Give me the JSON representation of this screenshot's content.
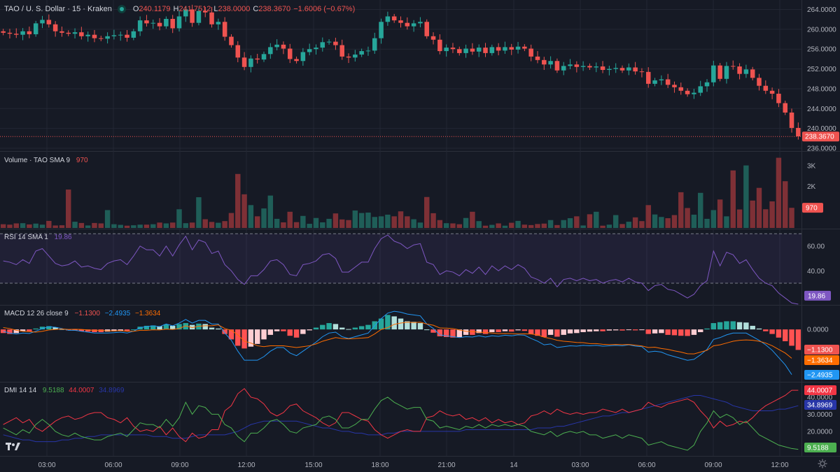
{
  "header": {
    "symbol": "TAO / U. S. Dollar · 15 · Kraken",
    "o_label": "O",
    "o_value": "240.1179",
    "h_label": "H",
    "h_value": "241.7512",
    "l_label": "L",
    "l_value": "238.0000",
    "c_label": "C",
    "c_value": "238.3670",
    "change": "−1.6006 (−0.67%)"
  },
  "colors": {
    "bg": "#161a25",
    "up": "#26a69a",
    "down": "#ef5350",
    "grid": "#232734",
    "rsi": "#7e57c2",
    "macd": "#2196f3",
    "signal": "#ff6d00",
    "dmi_plus": "#4caf50",
    "dmi_minus": "#f23645",
    "adx": "#2836a8"
  },
  "chart_data": [
    {
      "type": "candlestick",
      "title": "TAO / U. S. Dollar · 15 · Kraken",
      "ylim": [
        236,
        264.5
      ],
      "y_ticks": [
        "264.0000",
        "260.0000",
        "256.0000",
        "252.0000",
        "248.0000",
        "244.0000",
        "240.0000",
        "236.0000"
      ],
      "last_price_label": "238.3670",
      "last_price": 238.367,
      "x_ticks": [
        "03:00",
        "06:00",
        "09:00",
        "12:00",
        "15:00",
        "18:00",
        "21:00",
        "14",
        "03:00",
        "06:00",
        "09:00",
        "12:00"
      ],
      "close": [
        259.3,
        259.1,
        258.9,
        259.6,
        259.0,
        261.2,
        261.9,
        261.0,
        259.6,
        259.3,
        259.1,
        259.4,
        258.6,
        258.9,
        258.2,
        258.1,
        258.6,
        258.8,
        258.9,
        258.3,
        259.6,
        261.8,
        261.2,
        261.3,
        260.6,
        262.1,
        260.2,
        262.6,
        264.0,
        261.3,
        263.7,
        263.4,
        261.0,
        261.5,
        258.5,
        256.8,
        254.3,
        252.4,
        254.1,
        253.9,
        255.0,
        256.4,
        256.9,
        256.1,
        254.0,
        253.6,
        255.4,
        256.0,
        256.3,
        257.4,
        257.5,
        256.8,
        254.5,
        254.3,
        254.9,
        255.6,
        255.7,
        258.2,
        261.5,
        262.6,
        261.8,
        261.3,
        260.6,
        261.2,
        261.5,
        258.6,
        257.9,
        255.6,
        256.3,
        256.0,
        255.2,
        256.1,
        255.5,
        256.3,
        255.2,
        256.4,
        255.7,
        256.4,
        255.9,
        256.5,
        256.1,
        254.5,
        253.8,
        252.9,
        253.6,
        251.7,
        252.6,
        252.9,
        252.4,
        252.6,
        252.3,
        252.5,
        251.8,
        252.0,
        252.2,
        251.7,
        252.3,
        251.5,
        251.4,
        249.0,
        249.7,
        249.9,
        248.8,
        248.3,
        247.6,
        246.9,
        247.2,
        248.5,
        249.3,
        252.7,
        250.0,
        252.6,
        252.5,
        251.0,
        251.9,
        250.2,
        248.6,
        247.6,
        247.0,
        245.1,
        243.2,
        240.1,
        238.4
      ],
      "volume_title": "Volume · TAO SMA 9",
      "volume_sma": "970",
      "volume_ticks": [
        "3K",
        "2K"
      ],
      "volume_last_label": "970",
      "volume_ylim": [
        0,
        3400
      ],
      "volume": [
        180,
        160,
        220,
        230,
        170,
        210,
        160,
        340,
        120,
        130,
        1850,
        300,
        240,
        120,
        240,
        220,
        860,
        180,
        150,
        110,
        130,
        160,
        160,
        180,
        260,
        220,
        260,
        900,
        230,
        260,
        1480,
        420,
        290,
        250,
        330,
        720,
        2600,
        1620,
        1100,
        560,
        940,
        1560,
        440,
        270,
        780,
        280,
        580,
        200,
        480,
        270,
        440,
        700,
        410,
        380,
        840,
        720,
        740,
        530,
        560,
        640,
        560,
        800,
        560,
        420,
        260,
        1490,
        710,
        380,
        230,
        220,
        180,
        480,
        780,
        330,
        110,
        150,
        220,
        110,
        250,
        340,
        160,
        140,
        190,
        210,
        380,
        140,
        380,
        470,
        560,
        120,
        660,
        780,
        110,
        160,
        620,
        190,
        300,
        510,
        330,
        1100,
        650,
        530,
        470,
        620,
        1720,
        960,
        640,
        1690,
        440,
        860,
        1370,
        560,
        2770,
        890,
        3010,
        1320,
        1930,
        900,
        1280,
        3380,
        2250,
        970
      ],
      "rsi_title": "RSI 14 SMA 1",
      "rsi_last": "19.86",
      "rsi_ticks": [
        "60.00",
        "40.00"
      ],
      "rsi_ylim": [
        13,
        73
      ],
      "rsi_bands": [
        70,
        30
      ],
      "rsi": [
        48,
        47,
        45,
        49,
        46,
        56,
        58,
        52,
        46,
        44,
        45,
        48,
        43,
        44,
        42,
        41,
        46,
        48,
        49,
        45,
        52,
        60,
        57,
        57,
        52,
        60,
        52,
        61,
        68,
        57,
        65,
        63,
        54,
        56,
        45,
        40,
        33,
        29,
        36,
        36,
        41,
        48,
        49,
        45,
        37,
        36,
        45,
        46,
        48,
        53,
        54,
        50,
        39,
        39,
        43,
        47,
        47,
        58,
        66,
        69,
        64,
        62,
        58,
        61,
        62,
        47,
        45,
        37,
        40,
        39,
        36,
        41,
        38,
        43,
        37,
        44,
        40,
        44,
        41,
        45,
        42,
        35,
        33,
        30,
        34,
        27,
        33,
        34,
        32,
        34,
        32,
        33,
        30,
        32,
        33,
        31,
        34,
        31,
        30,
        24,
        28,
        29,
        25,
        24,
        21,
        18,
        21,
        28,
        32,
        56,
        44,
        55,
        53,
        46,
        49,
        41,
        34,
        30,
        28,
        22,
        18,
        14,
        13
      ],
      "macd_title": "MACD 12 26 close 9",
      "macd_values": [
        "−1.1300",
        "−2.4935",
        "−1.3634"
      ],
      "macd_ticks": [
        "0.0000",
        "−1.0000",
        "−2.0000"
      ],
      "macd_ylim": [
        -2.85,
        1.2
      ],
      "macd_hist": [
        -0.2,
        -0.25,
        -0.2,
        -0.1,
        -0.1,
        0.05,
        0.15,
        0.18,
        0.12,
        0.02,
        -0.05,
        -0.06,
        -0.1,
        -0.12,
        -0.15,
        -0.15,
        -0.12,
        -0.1,
        -0.08,
        -0.1,
        0.0,
        0.15,
        0.2,
        0.22,
        0.18,
        0.28,
        0.2,
        0.3,
        0.35,
        0.25,
        0.32,
        0.3,
        0.1,
        0.05,
        -0.25,
        -0.55,
        -0.9,
        -1.05,
        -0.95,
        -0.8,
        -0.55,
        -0.3,
        -0.1,
        -0.1,
        -0.35,
        -0.45,
        -0.25,
        -0.05,
        0.1,
        0.25,
        0.35,
        0.3,
        0.1,
        0.02,
        0.1,
        0.18,
        0.25,
        0.45,
        0.6,
        0.8,
        0.72,
        0.6,
        0.45,
        0.42,
        0.35,
        0.0,
        -0.18,
        -0.38,
        -0.42,
        -0.45,
        -0.42,
        -0.3,
        -0.3,
        -0.2,
        -0.25,
        -0.15,
        -0.15,
        -0.1,
        -0.12,
        -0.05,
        -0.08,
        -0.25,
        -0.35,
        -0.42,
        -0.3,
        -0.4,
        -0.3,
        -0.22,
        -0.2,
        -0.15,
        -0.12,
        -0.1,
        -0.1,
        -0.06,
        -0.05,
        -0.06,
        -0.02,
        -0.05,
        -0.04,
        -0.25,
        -0.22,
        -0.2,
        -0.3,
        -0.32,
        -0.35,
        -0.36,
        -0.3,
        -0.15,
        0.05,
        0.35,
        0.4,
        0.45,
        0.45,
        0.4,
        0.38,
        0.2,
        0.05,
        -0.1,
        -0.25,
        -0.45,
        -0.65,
        -0.9,
        -1.13
      ],
      "macd_line": [
        -0.1,
        -0.2,
        -0.25,
        -0.2,
        -0.22,
        -0.1,
        0.05,
        0.15,
        0.12,
        0.05,
        -0.05,
        -0.05,
        -0.1,
        -0.15,
        -0.2,
        -0.2,
        -0.2,
        -0.18,
        -0.15,
        -0.2,
        -0.1,
        0.1,
        0.15,
        0.2,
        0.15,
        0.3,
        0.2,
        0.35,
        0.55,
        0.35,
        0.5,
        0.5,
        0.3,
        0.3,
        -0.2,
        -0.6,
        -1.2,
        -1.7,
        -1.7,
        -1.7,
        -1.5,
        -1.2,
        -1.0,
        -1.0,
        -1.3,
        -1.45,
        -1.2,
        -0.95,
        -0.7,
        -0.4,
        -0.2,
        -0.15,
        -0.4,
        -0.5,
        -0.4,
        -0.3,
        -0.2,
        0.2,
        0.6,
        0.9,
        1.0,
        0.95,
        0.85,
        0.8,
        0.75,
        0.3,
        0.05,
        -0.3,
        -0.35,
        -0.4,
        -0.45,
        -0.4,
        -0.42,
        -0.35,
        -0.42,
        -0.35,
        -0.38,
        -0.32,
        -0.35,
        -0.3,
        -0.32,
        -0.5,
        -0.65,
        -0.85,
        -0.8,
        -1.0,
        -0.95,
        -0.9,
        -0.92,
        -0.88,
        -0.9,
        -0.88,
        -0.92,
        -0.9,
        -0.88,
        -0.9,
        -0.85,
        -0.92,
        -0.95,
        -1.25,
        -1.2,
        -1.25,
        -1.4,
        -1.5,
        -1.6,
        -1.7,
        -1.65,
        -1.4,
        -1.1,
        -0.55,
        -0.45,
        -0.3,
        -0.2,
        -0.2,
        -0.2,
        -0.4,
        -0.6,
        -0.85,
        -1.15,
        -1.55,
        -1.95,
        -2.49
      ],
      "dmi_title": "DMI 14 14",
      "dmi_values": [
        "9.5188",
        "44.0007",
        "34.8969"
      ],
      "dmi_ticks": [
        "40.0000",
        "30.0000",
        "20.0000"
      ],
      "dmi_ylim": [
        6.5,
        46.5
      ],
      "dmi_plus": [
        22,
        20,
        18,
        21,
        19,
        24,
        27,
        24,
        20,
        18,
        17,
        19,
        17,
        16,
        15,
        15,
        17,
        18,
        19,
        17,
        21,
        25,
        24,
        24,
        22,
        27,
        23,
        28,
        37,
        30,
        35,
        34,
        30,
        30,
        24,
        22,
        17,
        14,
        19,
        19,
        22,
        26,
        27,
        24,
        20,
        19,
        22,
        23,
        24,
        28,
        29,
        27,
        22,
        22,
        24,
        27,
        27,
        33,
        38,
        40,
        37,
        35,
        33,
        34,
        34,
        27,
        26,
        22,
        23,
        22,
        21,
        23,
        22,
        24,
        22,
        24,
        23,
        24,
        23,
        24,
        23,
        20,
        19,
        18,
        20,
        17,
        19,
        20,
        19,
        20,
        18,
        18,
        16,
        17,
        18,
        16,
        18,
        17,
        16,
        12,
        13,
        14,
        12,
        11,
        10,
        9,
        12,
        20,
        25,
        32,
        28,
        30,
        28,
        24,
        26,
        22,
        18,
        16,
        14,
        12,
        11,
        10,
        9.5
      ],
      "dmi_minus": [
        24,
        26,
        28,
        25,
        27,
        22,
        20,
        23,
        26,
        28,
        29,
        27,
        28,
        30,
        31,
        31,
        28,
        27,
        25,
        28,
        23,
        20,
        21,
        20,
        23,
        18,
        22,
        17,
        14,
        19,
        16,
        17,
        21,
        21,
        32,
        35,
        42,
        45,
        40,
        39,
        36,
        31,
        29,
        31,
        35,
        36,
        32,
        30,
        28,
        25,
        23,
        25,
        31,
        31,
        29,
        27,
        26,
        21,
        18,
        16,
        18,
        20,
        21,
        20,
        20,
        28,
        29,
        32,
        30,
        29,
        30,
        27,
        28,
        26,
        28,
        25,
        27,
        25,
        26,
        24,
        25,
        29,
        30,
        32,
        30,
        33,
        31,
        30,
        31,
        30,
        31,
        31,
        33,
        32,
        31,
        33,
        31,
        32,
        33,
        37,
        35,
        34,
        36,
        37,
        38,
        39,
        37,
        32,
        28,
        22,
        26,
        23,
        24,
        26,
        25,
        28,
        32,
        35,
        37,
        39,
        41,
        44,
        44
      ],
      "adx": [
        18,
        17,
        16,
        15,
        15,
        14,
        14,
        14,
        14,
        15,
        15,
        16,
        16,
        17,
        17,
        18,
        18,
        18,
        18,
        18,
        18,
        18,
        18,
        17,
        17,
        17,
        16,
        16,
        16,
        17,
        18,
        18,
        18,
        18,
        18,
        19,
        20,
        22,
        24,
        25,
        26,
        26,
        26,
        26,
        26,
        26,
        25,
        24,
        23,
        22,
        22,
        21,
        20,
        20,
        19,
        19,
        18,
        18,
        18,
        19,
        19,
        20,
        20,
        20,
        20,
        20,
        20,
        20,
        20,
        20,
        20,
        21,
        21,
        21,
        21,
        21,
        21,
        21,
        21,
        21,
        21,
        21,
        22,
        22,
        22,
        23,
        23,
        24,
        25,
        26,
        27,
        28,
        29,
        29,
        30,
        31,
        31,
        32,
        33,
        34,
        35,
        36,
        37,
        38,
        39,
        40,
        41,
        41,
        40,
        39,
        38,
        37,
        35,
        34,
        33,
        32,
        32,
        32,
        32,
        33,
        33,
        34,
        35
      ]
    }
  ]
}
